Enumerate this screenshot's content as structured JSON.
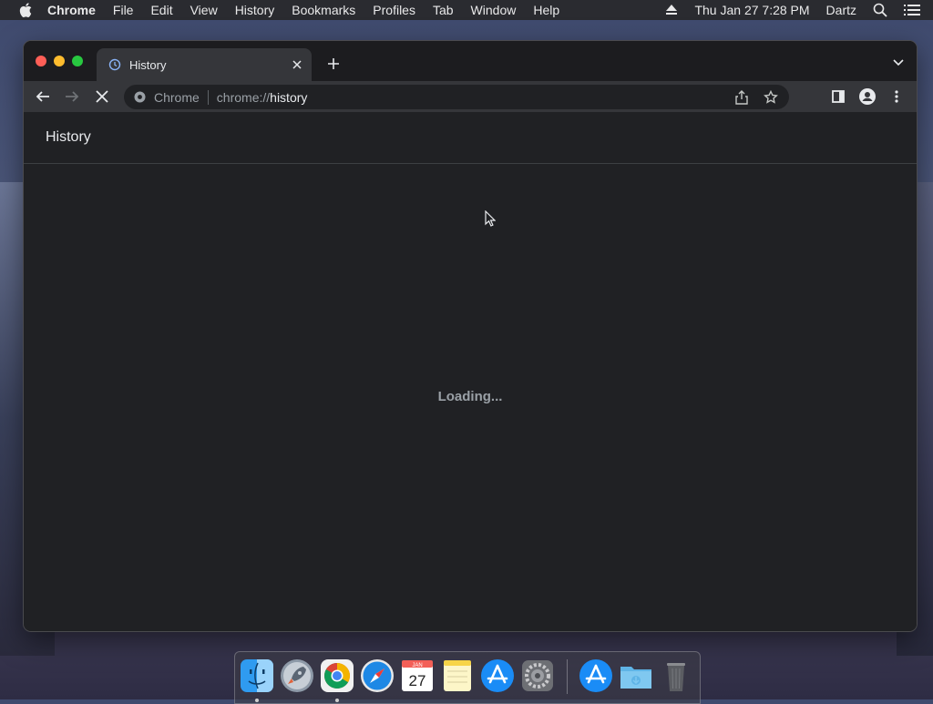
{
  "menubar": {
    "app": "Chrome",
    "items": [
      "File",
      "Edit",
      "View",
      "History",
      "Bookmarks",
      "Profiles",
      "Tab",
      "Window",
      "Help"
    ],
    "datetime": "Thu Jan 27  7:28 PM",
    "user": "Dartz"
  },
  "tab": {
    "title": "History"
  },
  "omnibox": {
    "chip": "Chrome",
    "url_prefix": "chrome://",
    "url_path": "history"
  },
  "page": {
    "title": "History",
    "loading": "Loading..."
  },
  "dock": {
    "items": [
      "Finder",
      "Launchpad",
      "Google Chrome",
      "Safari",
      "Calendar",
      "Notes",
      "App Store",
      "System Preferences",
      "App Store",
      "Downloads",
      "Trash"
    ],
    "calendar_day": "27",
    "calendar_month": "JAN"
  },
  "colors": {
    "accent": "#8ab4f8",
    "background": "#202124",
    "toolbar": "#35363a"
  }
}
